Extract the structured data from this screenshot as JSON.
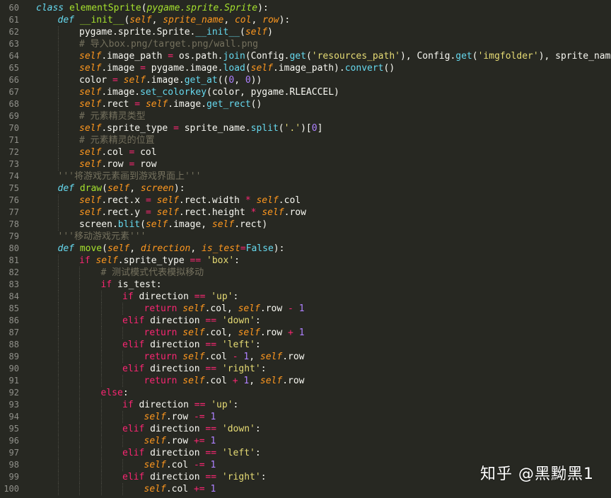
{
  "theme": {
    "background": "#272822",
    "foreground": "#f8f8f2",
    "line_number": "#90908a"
  },
  "watermark": "知乎 @黑黝黑1",
  "lines": [
    {
      "n": "60",
      "indent": 0,
      "tokens": [
        [
          "kw",
          "class"
        ],
        [
          "tx",
          " "
        ],
        [
          "cls",
          "elementSprite"
        ],
        [
          "tx",
          "("
        ],
        [
          "sup",
          "pygame.sprite.Sprite"
        ],
        [
          "tx",
          "):"
        ]
      ]
    },
    {
      "n": "61",
      "indent": 1,
      "tokens": [
        [
          "kw",
          "def"
        ],
        [
          "tx",
          " "
        ],
        [
          "fn",
          "__init__"
        ],
        [
          "tx",
          "("
        ],
        [
          "self",
          "self"
        ],
        [
          "tx",
          ", "
        ],
        [
          "param",
          "sprite_name"
        ],
        [
          "tx",
          ", "
        ],
        [
          "param",
          "col"
        ],
        [
          "tx",
          ", "
        ],
        [
          "param",
          "row"
        ],
        [
          "tx",
          "):"
        ]
      ]
    },
    {
      "n": "62",
      "indent": 2,
      "tokens": [
        [
          "tx",
          "pygame.sprite.Sprite."
        ],
        [
          "builtin",
          "__init__"
        ],
        [
          "tx",
          "("
        ],
        [
          "self",
          "self"
        ],
        [
          "tx",
          ")"
        ]
      ]
    },
    {
      "n": "63",
      "indent": 2,
      "tokens": [
        [
          "com",
          "# 导入box.png/target.png/wall.png"
        ]
      ]
    },
    {
      "n": "64",
      "indent": 2,
      "tokens": [
        [
          "self",
          "self"
        ],
        [
          "tx",
          ".image_path "
        ],
        [
          "op",
          "="
        ],
        [
          "tx",
          " os.path."
        ],
        [
          "builtin",
          "join"
        ],
        [
          "tx",
          "(Config."
        ],
        [
          "builtin",
          "get"
        ],
        [
          "tx",
          "("
        ],
        [
          "str",
          "'resources_path'"
        ],
        [
          "tx",
          "), Config."
        ],
        [
          "builtin",
          "get"
        ],
        [
          "tx",
          "("
        ],
        [
          "str",
          "'imgfolder'"
        ],
        [
          "tx",
          "), sprite_name)"
        ]
      ]
    },
    {
      "n": "65",
      "indent": 2,
      "tokens": [
        [
          "self",
          "self"
        ],
        [
          "tx",
          ".image "
        ],
        [
          "op",
          "="
        ],
        [
          "tx",
          " pygame.image."
        ],
        [
          "builtin",
          "load"
        ],
        [
          "tx",
          "("
        ],
        [
          "self",
          "self"
        ],
        [
          "tx",
          ".image_path)."
        ],
        [
          "builtin",
          "convert"
        ],
        [
          "tx",
          "()"
        ]
      ]
    },
    {
      "n": "66",
      "indent": 2,
      "tokens": [
        [
          "tx",
          "color "
        ],
        [
          "op",
          "="
        ],
        [
          "tx",
          " "
        ],
        [
          "self",
          "self"
        ],
        [
          "tx",
          ".image."
        ],
        [
          "builtin",
          "get_at"
        ],
        [
          "tx",
          "(("
        ],
        [
          "num",
          "0"
        ],
        [
          "tx",
          ", "
        ],
        [
          "num",
          "0"
        ],
        [
          "tx",
          "))"
        ]
      ]
    },
    {
      "n": "67",
      "indent": 2,
      "tokens": [
        [
          "self",
          "self"
        ],
        [
          "tx",
          ".image."
        ],
        [
          "builtin",
          "set_colorkey"
        ],
        [
          "tx",
          "(color, pygame.RLEACCEL)"
        ]
      ]
    },
    {
      "n": "68",
      "indent": 2,
      "tokens": [
        [
          "self",
          "self"
        ],
        [
          "tx",
          ".rect "
        ],
        [
          "op",
          "="
        ],
        [
          "tx",
          " "
        ],
        [
          "self",
          "self"
        ],
        [
          "tx",
          ".image."
        ],
        [
          "builtin",
          "get_rect"
        ],
        [
          "tx",
          "()"
        ]
      ]
    },
    {
      "n": "69",
      "indent": 2,
      "tokens": [
        [
          "com",
          "# 元素精灵类型"
        ]
      ]
    },
    {
      "n": "70",
      "indent": 2,
      "tokens": [
        [
          "self",
          "self"
        ],
        [
          "tx",
          ".sprite_type "
        ],
        [
          "op",
          "="
        ],
        [
          "tx",
          " sprite_name."
        ],
        [
          "builtin",
          "split"
        ],
        [
          "tx",
          "("
        ],
        [
          "str",
          "'.'"
        ],
        [
          "tx",
          ")["
        ],
        [
          "num",
          "0"
        ],
        [
          "tx",
          "]"
        ]
      ]
    },
    {
      "n": "71",
      "indent": 2,
      "tokens": [
        [
          "com",
          "# 元素精灵的位置"
        ]
      ]
    },
    {
      "n": "72",
      "indent": 2,
      "tokens": [
        [
          "self",
          "self"
        ],
        [
          "tx",
          ".col "
        ],
        [
          "op",
          "="
        ],
        [
          "tx",
          " col"
        ]
      ]
    },
    {
      "n": "73",
      "indent": 2,
      "tokens": [
        [
          "self",
          "self"
        ],
        [
          "tx",
          ".row "
        ],
        [
          "op",
          "="
        ],
        [
          "tx",
          " row"
        ]
      ]
    },
    {
      "n": "74",
      "indent": 1,
      "tokens": [
        [
          "com",
          "'''将游戏元素画到游戏界面上'''"
        ]
      ]
    },
    {
      "n": "75",
      "indent": 1,
      "tokens": [
        [
          "kw",
          "def"
        ],
        [
          "tx",
          " "
        ],
        [
          "fn",
          "draw"
        ],
        [
          "tx",
          "("
        ],
        [
          "self",
          "self"
        ],
        [
          "tx",
          ", "
        ],
        [
          "param",
          "screen"
        ],
        [
          "tx",
          "):"
        ]
      ]
    },
    {
      "n": "76",
      "indent": 2,
      "tokens": [
        [
          "self",
          "self"
        ],
        [
          "tx",
          ".rect.x "
        ],
        [
          "op",
          "="
        ],
        [
          "tx",
          " "
        ],
        [
          "self",
          "self"
        ],
        [
          "tx",
          ".rect.width "
        ],
        [
          "op",
          "*"
        ],
        [
          "tx",
          " "
        ],
        [
          "self",
          "self"
        ],
        [
          "tx",
          ".col"
        ]
      ]
    },
    {
      "n": "77",
      "indent": 2,
      "tokens": [
        [
          "self",
          "self"
        ],
        [
          "tx",
          ".rect.y "
        ],
        [
          "op",
          "="
        ],
        [
          "tx",
          " "
        ],
        [
          "self",
          "self"
        ],
        [
          "tx",
          ".rect.height "
        ],
        [
          "op",
          "*"
        ],
        [
          "tx",
          " "
        ],
        [
          "self",
          "self"
        ],
        [
          "tx",
          ".row"
        ]
      ]
    },
    {
      "n": "78",
      "indent": 2,
      "tokens": [
        [
          "tx",
          "screen."
        ],
        [
          "builtin",
          "blit"
        ],
        [
          "tx",
          "("
        ],
        [
          "self",
          "self"
        ],
        [
          "tx",
          ".image, "
        ],
        [
          "self",
          "self"
        ],
        [
          "tx",
          ".rect)"
        ]
      ]
    },
    {
      "n": "79",
      "indent": 1,
      "tokens": [
        [
          "com",
          "'''移动游戏元素'''"
        ]
      ]
    },
    {
      "n": "80",
      "indent": 1,
      "tokens": [
        [
          "kw",
          "def"
        ],
        [
          "tx",
          " "
        ],
        [
          "fn",
          "move"
        ],
        [
          "tx",
          "("
        ],
        [
          "self",
          "self"
        ],
        [
          "tx",
          ", "
        ],
        [
          "param",
          "direction"
        ],
        [
          "tx",
          ", "
        ],
        [
          "param",
          "is_test"
        ],
        [
          "op",
          "="
        ],
        [
          "builtin",
          "False"
        ],
        [
          "tx",
          "):"
        ]
      ]
    },
    {
      "n": "81",
      "indent": 2,
      "tokens": [
        [
          "kw2",
          "if"
        ],
        [
          "tx",
          " "
        ],
        [
          "self",
          "self"
        ],
        [
          "tx",
          ".sprite_type "
        ],
        [
          "op",
          "=="
        ],
        [
          "tx",
          " "
        ],
        [
          "str",
          "'box'"
        ],
        [
          "tx",
          ":"
        ]
      ]
    },
    {
      "n": "82",
      "indent": 3,
      "tokens": [
        [
          "com",
          "# 测试模式代表模拟移动"
        ]
      ]
    },
    {
      "n": "83",
      "indent": 3,
      "tokens": [
        [
          "kw2",
          "if"
        ],
        [
          "tx",
          " is_test:"
        ]
      ]
    },
    {
      "n": "84",
      "indent": 4,
      "tokens": [
        [
          "kw2",
          "if"
        ],
        [
          "tx",
          " direction "
        ],
        [
          "op",
          "=="
        ],
        [
          "tx",
          " "
        ],
        [
          "str",
          "'up'"
        ],
        [
          "tx",
          ":"
        ]
      ]
    },
    {
      "n": "85",
      "indent": 5,
      "tokens": [
        [
          "kw2",
          "return"
        ],
        [
          "tx",
          " "
        ],
        [
          "self",
          "self"
        ],
        [
          "tx",
          ".col, "
        ],
        [
          "self",
          "self"
        ],
        [
          "tx",
          ".row "
        ],
        [
          "op",
          "-"
        ],
        [
          "tx",
          " "
        ],
        [
          "num",
          "1"
        ]
      ]
    },
    {
      "n": "86",
      "indent": 4,
      "tokens": [
        [
          "kw2",
          "elif"
        ],
        [
          "tx",
          " direction "
        ],
        [
          "op",
          "=="
        ],
        [
          "tx",
          " "
        ],
        [
          "str",
          "'down'"
        ],
        [
          "tx",
          ":"
        ]
      ]
    },
    {
      "n": "87",
      "indent": 5,
      "tokens": [
        [
          "kw2",
          "return"
        ],
        [
          "tx",
          " "
        ],
        [
          "self",
          "self"
        ],
        [
          "tx",
          ".col, "
        ],
        [
          "self",
          "self"
        ],
        [
          "tx",
          ".row "
        ],
        [
          "op",
          "+"
        ],
        [
          "tx",
          " "
        ],
        [
          "num",
          "1"
        ]
      ]
    },
    {
      "n": "88",
      "indent": 4,
      "tokens": [
        [
          "kw2",
          "elif"
        ],
        [
          "tx",
          " direction "
        ],
        [
          "op",
          "=="
        ],
        [
          "tx",
          " "
        ],
        [
          "str",
          "'left'"
        ],
        [
          "tx",
          ":"
        ]
      ]
    },
    {
      "n": "89",
      "indent": 5,
      "tokens": [
        [
          "kw2",
          "return"
        ],
        [
          "tx",
          " "
        ],
        [
          "self",
          "self"
        ],
        [
          "tx",
          ".col "
        ],
        [
          "op",
          "-"
        ],
        [
          "tx",
          " "
        ],
        [
          "num",
          "1"
        ],
        [
          "tx",
          ", "
        ],
        [
          "self",
          "self"
        ],
        [
          "tx",
          ".row"
        ]
      ]
    },
    {
      "n": "90",
      "indent": 4,
      "tokens": [
        [
          "kw2",
          "elif"
        ],
        [
          "tx",
          " direction "
        ],
        [
          "op",
          "=="
        ],
        [
          "tx",
          " "
        ],
        [
          "str",
          "'right'"
        ],
        [
          "tx",
          ":"
        ]
      ]
    },
    {
      "n": "91",
      "indent": 5,
      "tokens": [
        [
          "kw2",
          "return"
        ],
        [
          "tx",
          " "
        ],
        [
          "self",
          "self"
        ],
        [
          "tx",
          ".col "
        ],
        [
          "op",
          "+"
        ],
        [
          "tx",
          " "
        ],
        [
          "num",
          "1"
        ],
        [
          "tx",
          ", "
        ],
        [
          "self",
          "self"
        ],
        [
          "tx",
          ".row"
        ]
      ]
    },
    {
      "n": "92",
      "indent": 3,
      "tokens": [
        [
          "kw2",
          "else"
        ],
        [
          "tx",
          ":"
        ]
      ]
    },
    {
      "n": "93",
      "indent": 4,
      "tokens": [
        [
          "kw2",
          "if"
        ],
        [
          "tx",
          " direction "
        ],
        [
          "op",
          "=="
        ],
        [
          "tx",
          " "
        ],
        [
          "str",
          "'up'"
        ],
        [
          "tx",
          ":"
        ]
      ]
    },
    {
      "n": "94",
      "indent": 5,
      "tokens": [
        [
          "self",
          "self"
        ],
        [
          "tx",
          ".row "
        ],
        [
          "op",
          "-="
        ],
        [
          "tx",
          " "
        ],
        [
          "num",
          "1"
        ]
      ]
    },
    {
      "n": "95",
      "indent": 4,
      "tokens": [
        [
          "kw2",
          "elif"
        ],
        [
          "tx",
          " direction "
        ],
        [
          "op",
          "=="
        ],
        [
          "tx",
          " "
        ],
        [
          "str",
          "'down'"
        ],
        [
          "tx",
          ":"
        ]
      ]
    },
    {
      "n": "96",
      "indent": 5,
      "tokens": [
        [
          "self",
          "self"
        ],
        [
          "tx",
          ".row "
        ],
        [
          "op",
          "+="
        ],
        [
          "tx",
          " "
        ],
        [
          "num",
          "1"
        ]
      ]
    },
    {
      "n": "97",
      "indent": 4,
      "tokens": [
        [
          "kw2",
          "elif"
        ],
        [
          "tx",
          " direction "
        ],
        [
          "op",
          "=="
        ],
        [
          "tx",
          " "
        ],
        [
          "str",
          "'left'"
        ],
        [
          "tx",
          ":"
        ]
      ]
    },
    {
      "n": "98",
      "indent": 5,
      "tokens": [
        [
          "self",
          "self"
        ],
        [
          "tx",
          ".col "
        ],
        [
          "op",
          "-="
        ],
        [
          "tx",
          " "
        ],
        [
          "num",
          "1"
        ]
      ]
    },
    {
      "n": "99",
      "indent": 4,
      "tokens": [
        [
          "kw2",
          "elif"
        ],
        [
          "tx",
          " direction "
        ],
        [
          "op",
          "=="
        ],
        [
          "tx",
          " "
        ],
        [
          "str",
          "'right'"
        ],
        [
          "tx",
          ":"
        ]
      ]
    },
    {
      "n": "100",
      "indent": 5,
      "tokens": [
        [
          "self",
          "self"
        ],
        [
          "tx",
          ".col "
        ],
        [
          "op",
          "+="
        ],
        [
          "tx",
          " "
        ],
        [
          "num",
          "1"
        ]
      ]
    }
  ]
}
